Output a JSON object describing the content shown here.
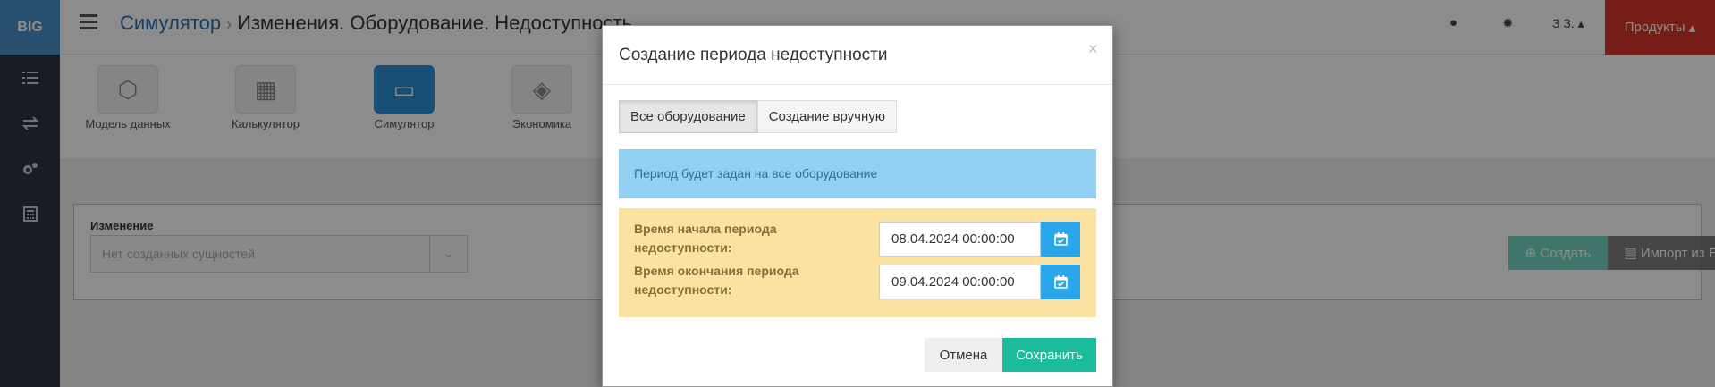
{
  "app": {
    "logo": "BIG",
    "breadcrumb": {
      "root": "Симулятор",
      "current": "Изменения. Оборудование. Недоступность"
    },
    "user_label": "З З.",
    "products_label": "Продукты"
  },
  "sidebar": {
    "icons": [
      "list-icon",
      "swap-icon",
      "cogs-icon",
      "calculator-icon"
    ]
  },
  "modules": [
    {
      "label": "Модель данных",
      "icon": "cubes-icon",
      "active": false
    },
    {
      "label": "Калькулятор",
      "icon": "calculator-icon",
      "active": false
    },
    {
      "label": "Симулятор",
      "icon": "monitor-icon",
      "active": true
    },
    {
      "label": "Экономика",
      "icon": "wallet-icon",
      "active": false
    }
  ],
  "panel": {
    "label": "Изменение",
    "select_value": "Нет созданных сущностей",
    "create_label": "Создать",
    "import_label": "Импорт из Excel"
  },
  "modal": {
    "title": "Создание периода недоступности",
    "close": "×",
    "tabs": [
      {
        "label": "Все оборудование",
        "active": true
      },
      {
        "label": "Создание вручную",
        "active": false
      }
    ],
    "info_text": "Период будет задан на все оборудование",
    "start": {
      "label": "Время начала периода недоступности:",
      "value": "08.04.2024 00:00:00"
    },
    "end": {
      "label": "Время окончания периода недоступности:",
      "value": "09.04.2024 00:00:00"
    },
    "cancel_label": "Отмена",
    "save_label": "Сохранить"
  },
  "colors": {
    "accent": "#2a8fd6",
    "success": "#1abc9c",
    "danger": "#d9362b",
    "info_bg": "#93d1f4",
    "warning_bg": "#fbe2a0"
  }
}
